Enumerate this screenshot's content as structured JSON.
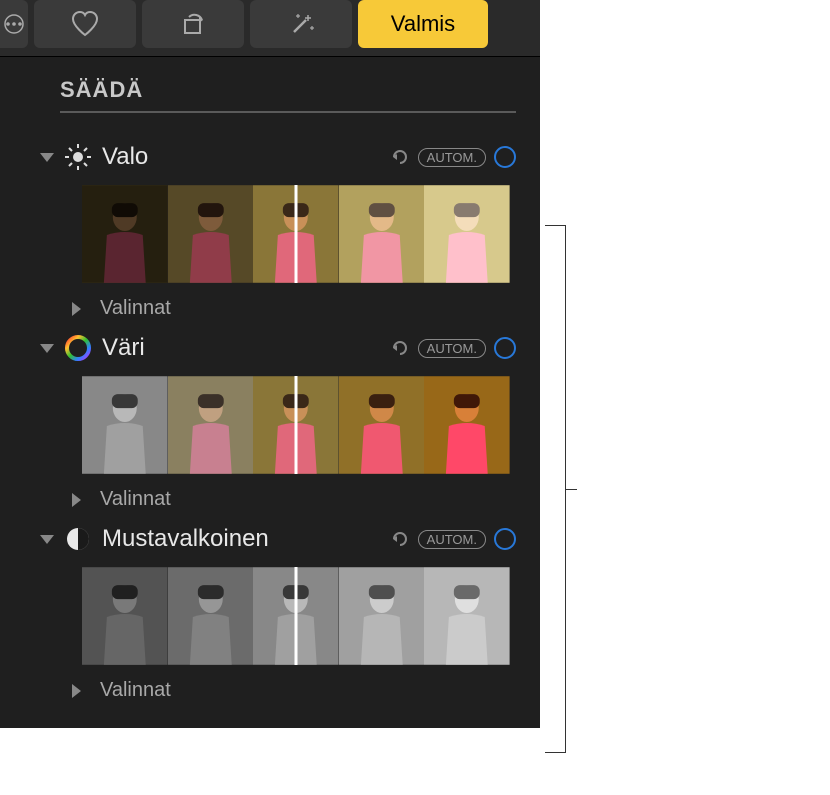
{
  "toolbar": {
    "done_label": "Valmis"
  },
  "section_title": "SÄÄDÄ",
  "groups": {
    "light": {
      "label": "Valo",
      "auto_label": "AUTOM.",
      "options_label": "Valinnat"
    },
    "color": {
      "label": "Väri",
      "auto_label": "AUTOM.",
      "options_label": "Valinnat"
    },
    "bw": {
      "label": "Mustavalkoinen",
      "auto_label": "AUTOM.",
      "options_label": "Valinnat"
    }
  }
}
